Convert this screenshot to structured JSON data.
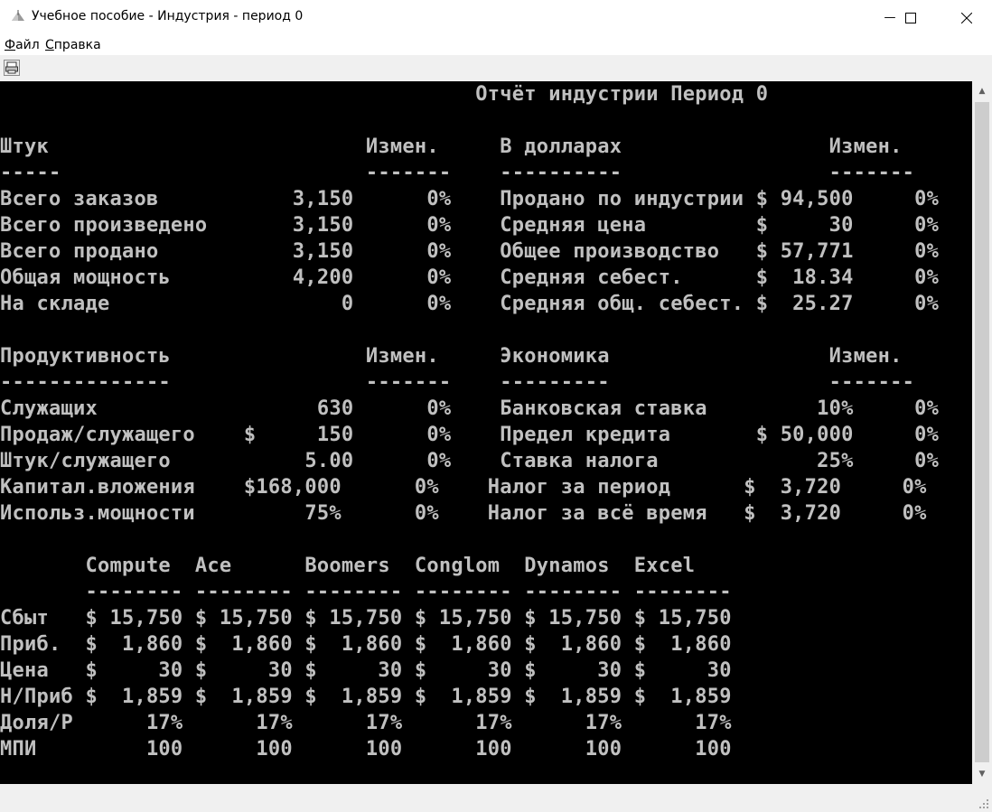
{
  "window": {
    "title": "Учебное пособие - Индустрия - период 0",
    "minimize_glyph": "—",
    "maximize_glyph": "☐",
    "close_glyph": "✕"
  },
  "menu": {
    "file_hotkey": "Ф",
    "file_rest": "айл",
    "help_hotkey": "С",
    "help_rest": "правка"
  },
  "icons": {
    "app": "app-triangle-icon",
    "toolbar": "print-icon"
  },
  "colors": {
    "console_bg": "#000000",
    "console_text": "#c0c0c0"
  },
  "console": {
    "lines": [
      "                                       Отчёт индустрии Период 0",
      "",
      "Штук                          Измен.     В долларах                 Измен.",
      "-----                         -------    ----------                 -------",
      "Всего заказов           3,150      0%    Продано по индустрии $ 94,500     0%",
      "Всего произведено       3,150      0%    Средняя цена         $     30     0%",
      "Всего продано           3,150      0%    Общее производство   $ 57,771     0%",
      "Общая мощность          4,200      0%    Средняя себест.      $  18.34     0%",
      "На складе                   0      0%    Средняя общ. себест. $  25.27     0%",
      "",
      "Продуктивность                Измен.     Экономика                  Измен.",
      "--------------                -------    ---------                  -------",
      "Служащих                  630      0%    Банковская ставка         10%     0%",
      "Продаж/служащего    $     150      0%    Предел кредита       $ 50,000     0%",
      "Штук/служащего           5.00      0%    Ставка налога             25%     0%",
      "Капитал.вложения    $168,000      0%    Налог за период      $  3,720     0%",
      "Использ.мощности         75%      0%    Налог за всё время   $  3,720     0%",
      "",
      "       Compute  Ace      Boomers  Conglom  Dynamos  Excel",
      "       -------- -------- -------- -------- -------- --------",
      "Сбыт   $ 15,750 $ 15,750 $ 15,750 $ 15,750 $ 15,750 $ 15,750",
      "Приб.  $  1,860 $  1,860 $  1,860 $  1,860 $  1,860 $  1,860",
      "Цена   $     30 $     30 $     30 $     30 $     30 $     30",
      "Н/Приб $  1,859 $  1,859 $  1,859 $  1,859 $  1,859 $  1,859",
      "Доля/Р      17%      17%      17%      17%      17%      17%",
      "МПИ         100      100      100      100      100      100"
    ]
  }
}
